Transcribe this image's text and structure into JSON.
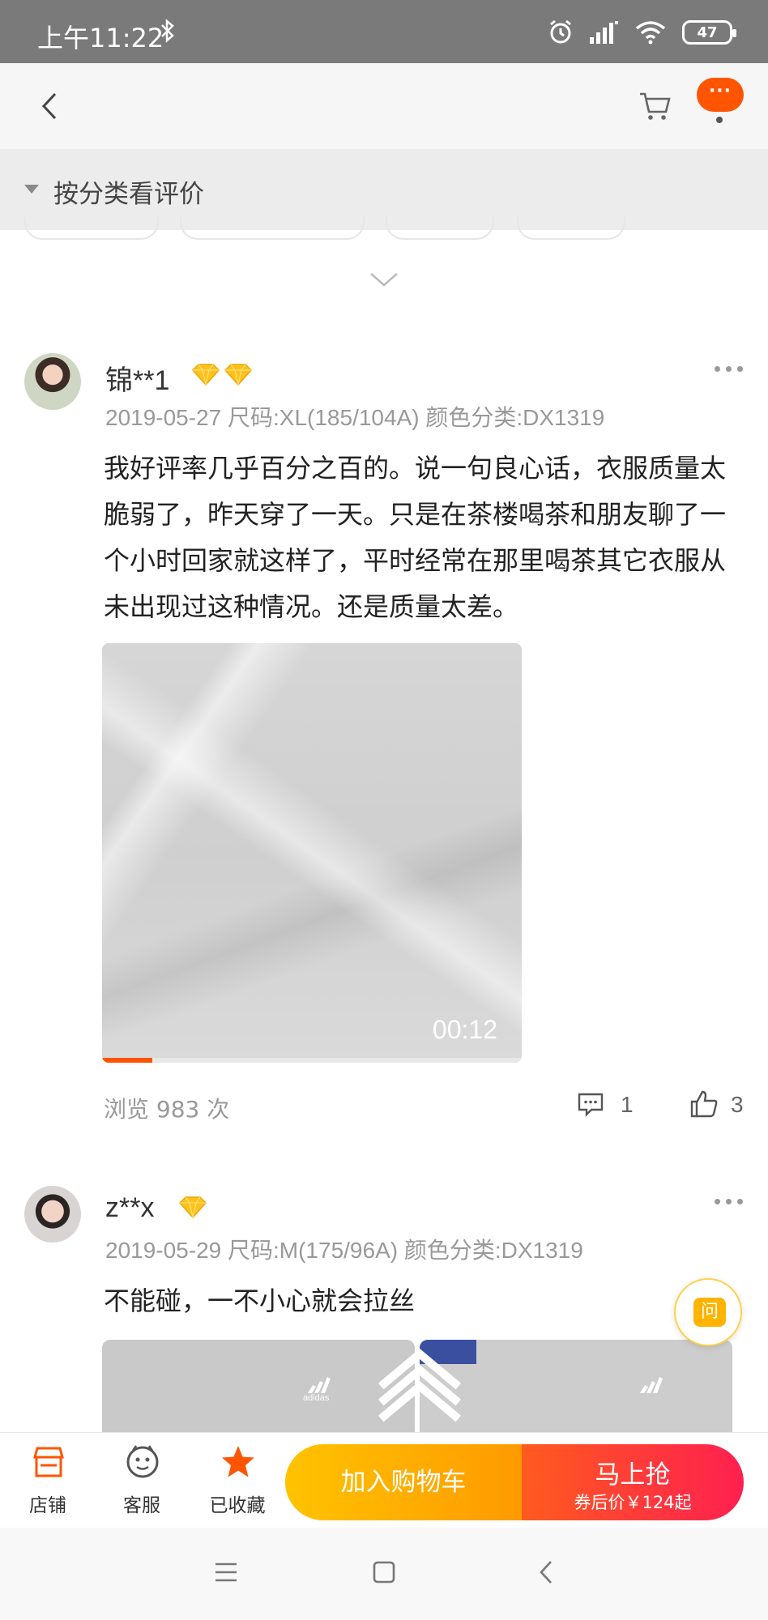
{
  "status_bar": {
    "time": "上午11:22",
    "bluetooth_icon": "bluetooth-icon",
    "battery": "47"
  },
  "nav": {
    "back_icon": "chevron-left-icon",
    "cart_icon": "cart-icon",
    "more_label": "···"
  },
  "filter": {
    "label": "按分类看评价"
  },
  "reviews": [
    {
      "username": "锦**1",
      "meta": "2019-05-27 尺码:XL(185/104A) 颜色分类:DX1319",
      "text": "我好评率几乎百分之百的。说一句良心话，衣服质量太脆弱了，昨天穿了一天。只是在茶楼喝茶和朋友聊了一个小时回家就这样了，平时经常在那里喝茶其它衣服从未出现过这种情况。还是质量太差。",
      "video_duration": "00:12",
      "video_progress": 0.12,
      "views": "浏览 983 次",
      "comments": "1",
      "likes": "3"
    },
    {
      "username": "z**x",
      "meta": "2019-05-29 尺码:M(175/96A) 颜色分类:DX1319",
      "text": "不能碰，一不小心就会拉丝",
      "image_logo_text": "adidas"
    }
  ],
  "ask_fab": {
    "label": "问"
  },
  "actions": {
    "store": "店铺",
    "service": "客服",
    "favorited": "已收藏",
    "add_to_cart": "加入购物车",
    "buy_now": "马上抢",
    "buy_now_sub": "券后价￥124起"
  },
  "colors": {
    "accent": "#ff5500",
    "cart_button": "#ffa800",
    "buy_button": "#ff3040"
  }
}
